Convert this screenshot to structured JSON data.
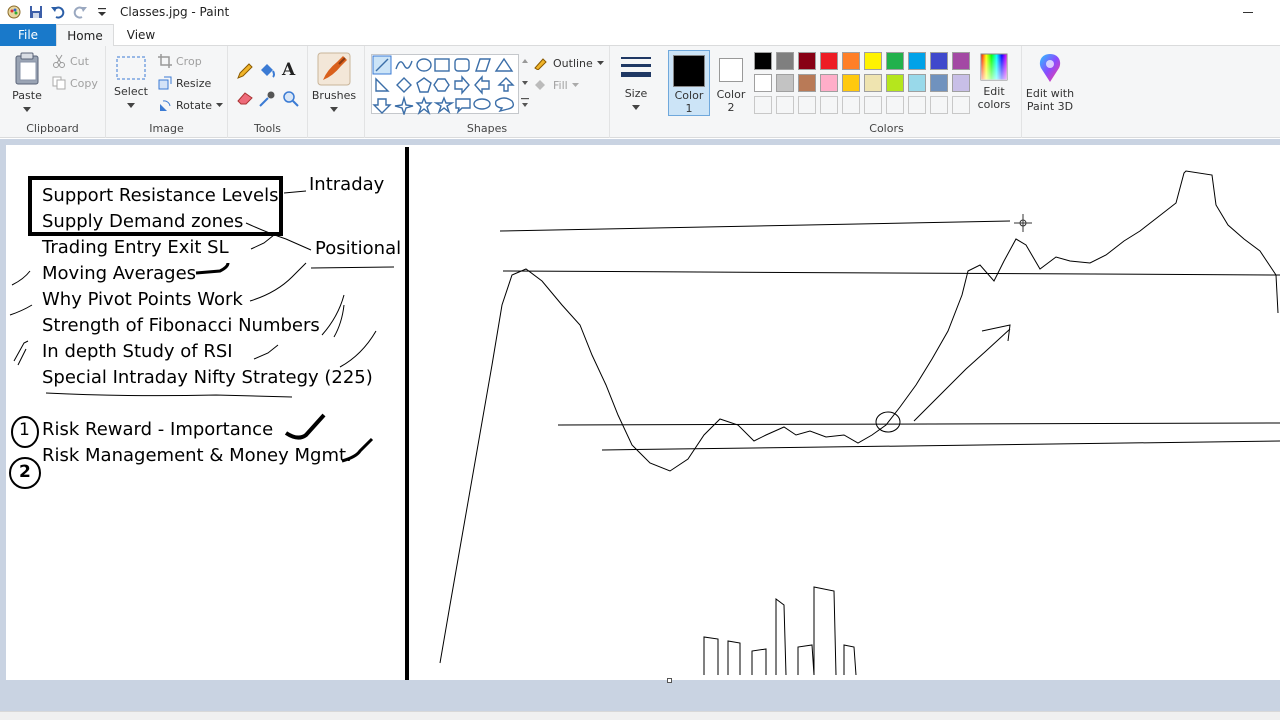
{
  "window": {
    "title": "Classes.jpg - Paint"
  },
  "tabs": {
    "file": "File",
    "home": "Home",
    "view": "View"
  },
  "ribbon": {
    "clipboard": {
      "label": "Clipboard",
      "paste": "Paste",
      "cut": "Cut",
      "copy": "Copy"
    },
    "image": {
      "label": "Image",
      "select": "Select",
      "crop": "Crop",
      "resize": "Resize",
      "rotate": "Rotate"
    },
    "tools": {
      "label": "Tools"
    },
    "brushes": {
      "label": "Brushes"
    },
    "shapes": {
      "label": "Shapes",
      "outline": "Outline",
      "fill": "Fill"
    },
    "size": {
      "label": "Size"
    },
    "color1": {
      "line1": "Color",
      "line2": "1"
    },
    "color2": {
      "line1": "Color",
      "line2": "2"
    },
    "colors": {
      "label": "Colors",
      "edit_line1": "Edit",
      "edit_line2": "colors",
      "palette_row1": [
        "#000000",
        "#7f7f7f",
        "#880015",
        "#ed1c24",
        "#ff7f27",
        "#fff200",
        "#22b14c",
        "#00a2e8",
        "#3f48cc",
        "#a349a4"
      ],
      "palette_row2": [
        "#ffffff",
        "#c3c3c3",
        "#b97a57",
        "#ffaec9",
        "#ffc90e",
        "#efe4b0",
        "#b5e61d",
        "#99d9ea",
        "#7092be",
        "#c8bfe7"
      ]
    },
    "paint3d": {
      "line1": "Edit with",
      "line2": "Paint 3D"
    }
  },
  "canvas_text": {
    "item1": "Support Resistance Levels",
    "item2": "Supply Demand zones",
    "item3": "Trading Entry Exit SL",
    "item4": "Moving Averages",
    "item5": "Why Pivot Points Work",
    "item6": "Strength of Fibonacci Numbers",
    "item7": "In depth Study of RSI",
    "item8": "Special Intraday Nifty Strategy (225)",
    "item9": "Risk Reward - Importance",
    "item10": "Risk Management & Money Mgmt.",
    "tag_intraday": "Intraday",
    "tag_positional": "Positional",
    "num1": "1",
    "num2": "2"
  }
}
